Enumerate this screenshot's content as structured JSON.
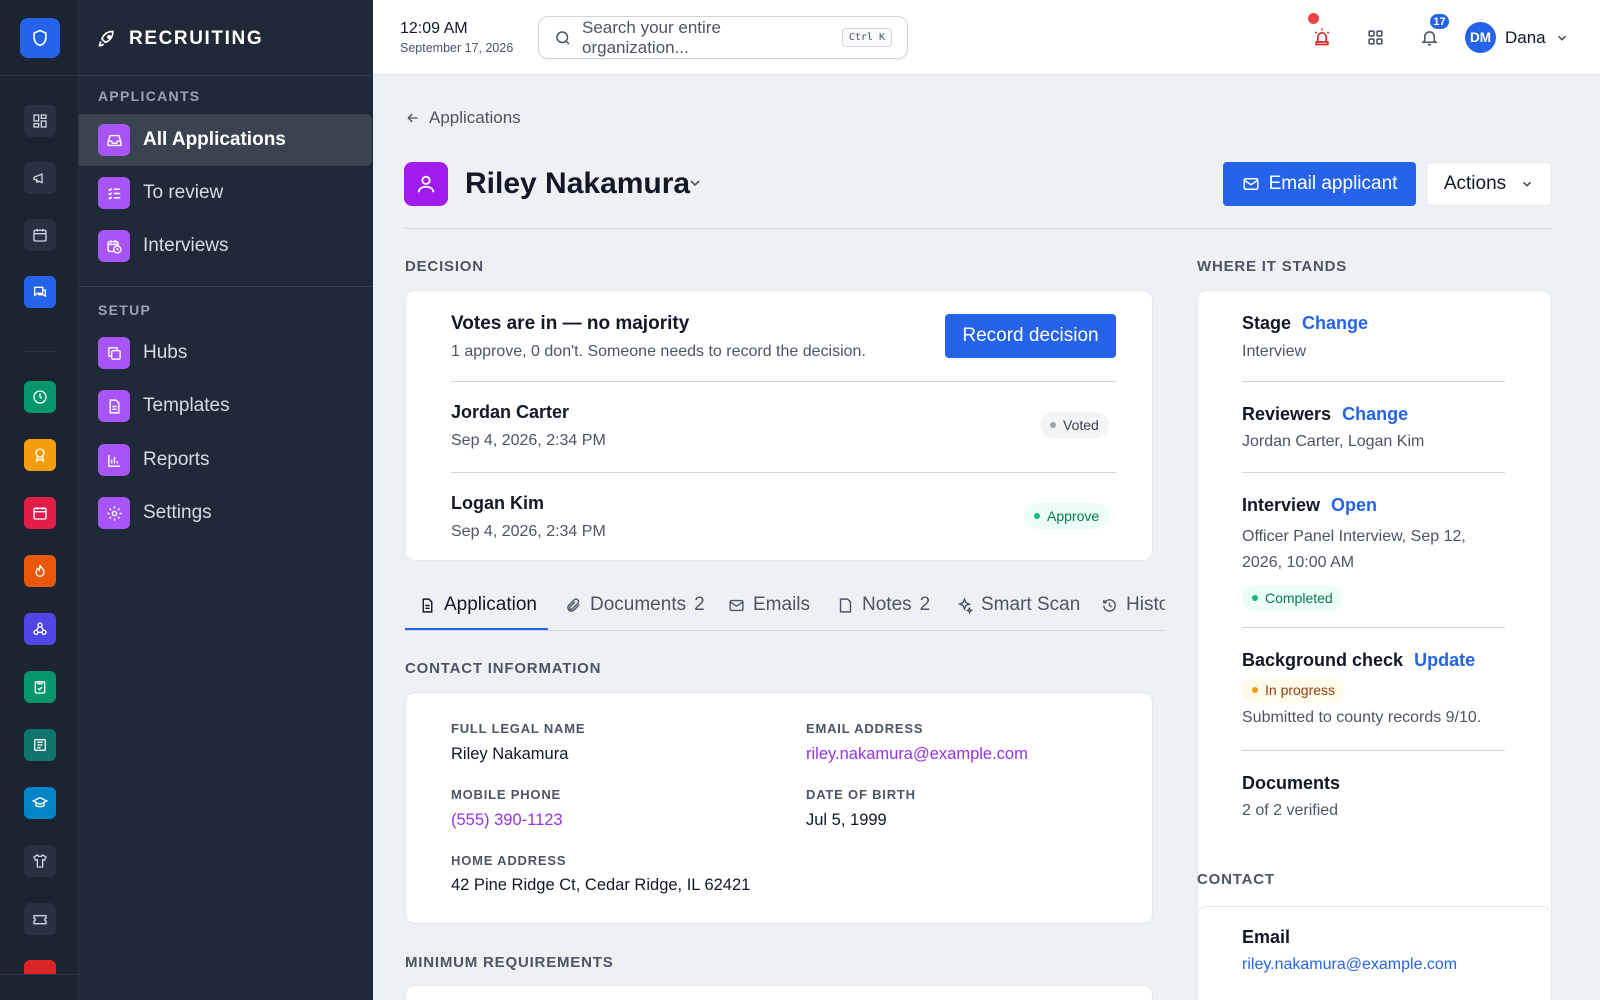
{
  "app": {
    "section_title": "RECRUITING"
  },
  "sidebar": {
    "sections": [
      {
        "title": "APPLICANTS",
        "items": [
          {
            "label": "All Applications",
            "icon": "inbox-icon"
          },
          {
            "label": "To review",
            "icon": "list-check-icon"
          },
          {
            "label": "Interviews",
            "icon": "calendar-clock-icon"
          }
        ]
      },
      {
        "title": "SETUP",
        "items": [
          {
            "label": "Hubs",
            "icon": "copy-icon"
          },
          {
            "label": "Templates",
            "icon": "file-icon"
          },
          {
            "label": "Reports",
            "icon": "bar-chart-icon"
          },
          {
            "label": "Settings",
            "icon": "gear-icon"
          }
        ]
      }
    ]
  },
  "topbar": {
    "time": "12:09 AM",
    "date": "September 17, 2026",
    "search_placeholder": "Search your entire organization...",
    "search_shortcut": "Ctrl K",
    "notification_count": "17",
    "user_initials": "DM",
    "user_name": "Dana"
  },
  "page": {
    "back_label": "Applications",
    "applicant_name": "Riley Nakamura",
    "email_button": "Email applicant",
    "actions_button": "Actions"
  },
  "decision": {
    "section_label": "DECISION",
    "headline": "Votes are in — no majority",
    "summary": "1 approve, 0 don't. Someone needs to record the decision.",
    "record_button": "Record decision",
    "votes": [
      {
        "name": "Jordan Carter",
        "time": "Sep 4, 2026, 2:34 PM",
        "status": "Voted"
      },
      {
        "name": "Logan Kim",
        "time": "Sep 4, 2026, 2:34 PM",
        "status": "Approve"
      }
    ]
  },
  "tabs": [
    {
      "label": "Application",
      "count": "",
      "icon": "file-text-icon"
    },
    {
      "label": "Documents",
      "count": "2",
      "icon": "paperclip-icon"
    },
    {
      "label": "Emails",
      "count": "",
      "icon": "mail-icon"
    },
    {
      "label": "Notes",
      "count": "2",
      "icon": "note-icon"
    },
    {
      "label": "Smart Scan",
      "count": "",
      "icon": "sparkles-icon"
    },
    {
      "label": "History",
      "count": "",
      "icon": "history-icon"
    }
  ],
  "contact_info": {
    "section_label": "CONTACT INFORMATION",
    "fields": {
      "full_name": {
        "label": "FULL LEGAL NAME",
        "value": "Riley Nakamura"
      },
      "email": {
        "label": "EMAIL ADDRESS",
        "value": "riley.nakamura@example.com"
      },
      "phone": {
        "label": "MOBILE PHONE",
        "value": "(555) 390-1123"
      },
      "dob": {
        "label": "DATE OF BIRTH",
        "value": "Jul 5, 1999"
      },
      "address": {
        "label": "HOME ADDRESS",
        "value": "42 Pine Ridge Ct, Cedar Ridge, IL 62421"
      }
    }
  },
  "min_requirements": {
    "section_label": "MINIMUM REQUIREMENTS"
  },
  "status_panel": {
    "section_label": "WHERE IT STANDS",
    "stage": {
      "title": "Stage",
      "action": "Change",
      "value": "Interview"
    },
    "reviewers": {
      "title": "Reviewers",
      "action": "Change",
      "value": "Jordan Carter, Logan Kim"
    },
    "interview": {
      "title": "Interview",
      "action": "Open",
      "value_line1": "Officer Panel Interview, Sep 12,",
      "value_line2": "2026, 10:00 AM",
      "status": "Completed"
    },
    "background": {
      "title": "Background check",
      "action": "Update",
      "status": "In progress",
      "note": "Submitted to county records 9/10."
    },
    "documents": {
      "title": "Documents",
      "value": "2 of 2 verified"
    }
  },
  "contact_panel": {
    "section_label": "CONTACT",
    "email_title": "Email",
    "email_value": "riley.nakamura@example.com"
  },
  "colors": {
    "accent": "#2563eb",
    "purple": "#a855f7",
    "success": "#10b981",
    "warning": "#f59e0b",
    "sidebar": "#1f2937"
  }
}
